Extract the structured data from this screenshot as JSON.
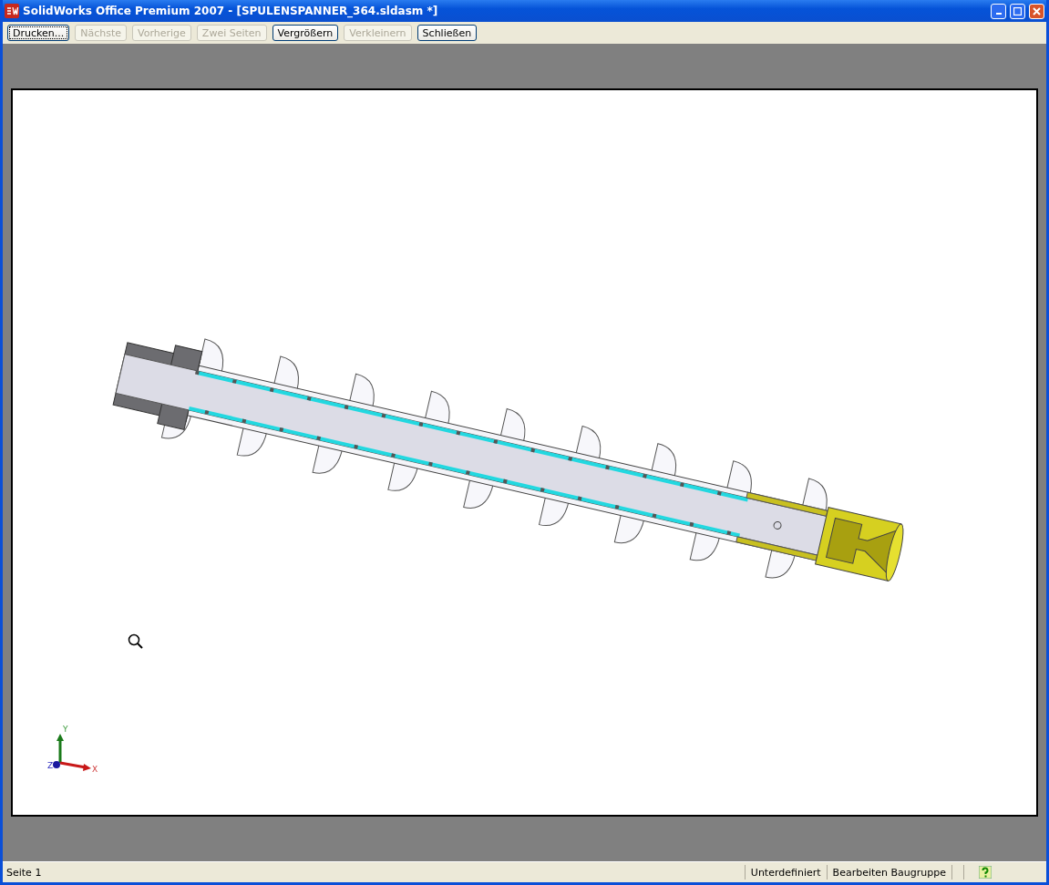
{
  "window": {
    "title": "SolidWorks Office Premium 2007 - [SPULENSPANNER_364.sldasm *]"
  },
  "toolbar": {
    "buttons": [
      {
        "label": "Drucken...",
        "disabled": false,
        "focused": true
      },
      {
        "label": "Nächste",
        "disabled": true,
        "focused": false
      },
      {
        "label": "Vorherige",
        "disabled": true,
        "focused": false
      },
      {
        "label": "Zwei Seiten",
        "disabled": true,
        "focused": false
      },
      {
        "label": "Vergrößern",
        "disabled": false,
        "focused": false
      },
      {
        "label": "Verkleinern",
        "disabled": true,
        "focused": false
      },
      {
        "label": "Schließen",
        "disabled": false,
        "focused": false
      }
    ]
  },
  "preview": {
    "triad": {
      "x": "X",
      "y": "Y",
      "z": "Z"
    }
  },
  "status_bar": {
    "page": "Seite 1",
    "state": "Unterdefiniert",
    "mode": "Bearbeiten Baugruppe"
  }
}
